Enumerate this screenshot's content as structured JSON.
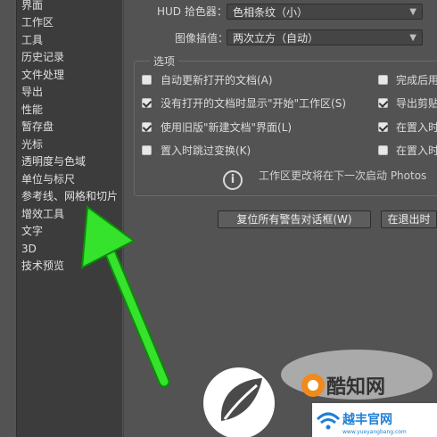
{
  "sidebar": {
    "items": [
      {
        "label": "界面"
      },
      {
        "label": "工作区"
      },
      {
        "label": "工具"
      },
      {
        "label": "历史记录"
      },
      {
        "label": "文件处理"
      },
      {
        "label": "导出"
      },
      {
        "label": "性能"
      },
      {
        "label": "暂存盘"
      },
      {
        "label": "光标"
      },
      {
        "label": "透明度与色域"
      },
      {
        "label": "单位与标尺"
      },
      {
        "label": "参考线、网格和切片"
      },
      {
        "label": "增效工具"
      },
      {
        "label": "文字"
      },
      {
        "label": "3D"
      },
      {
        "label": "技术预览"
      }
    ]
  },
  "settings": {
    "hud_label": "HUD 拾色器：",
    "hud_value": "色相条纹（小）",
    "interp_label": "图像插值：",
    "interp_value": "两次立方（自动）"
  },
  "options": {
    "legend": "选项",
    "left": [
      {
        "label": "自动更新打开的文档(A)",
        "checked": false
      },
      {
        "label": "没有打开的文档时显示\"开始\"工作区(S)",
        "checked": true
      },
      {
        "label": "使用旧版\"新建文档\"界面(L)",
        "checked": true
      },
      {
        "label": "置入时跳过变换(K)",
        "checked": false
      }
    ],
    "right": [
      {
        "label": "完成后用",
        "checked": false
      },
      {
        "label": "导出剪贴",
        "checked": true
      },
      {
        "label": "在置入时",
        "checked": true
      },
      {
        "label": "在置入时",
        "checked": false
      }
    ],
    "info_icon": "info-icon",
    "info_text": "工作区更改将在下一次启动 Photos"
  },
  "buttons": {
    "reset_warnings": "复位所有警告对话框(W)",
    "on_exit": "在退出时"
  },
  "watermark": {
    "text1": "酷知网",
    "text2": "越丰官网",
    "url": "www.yueyangbang.com"
  }
}
